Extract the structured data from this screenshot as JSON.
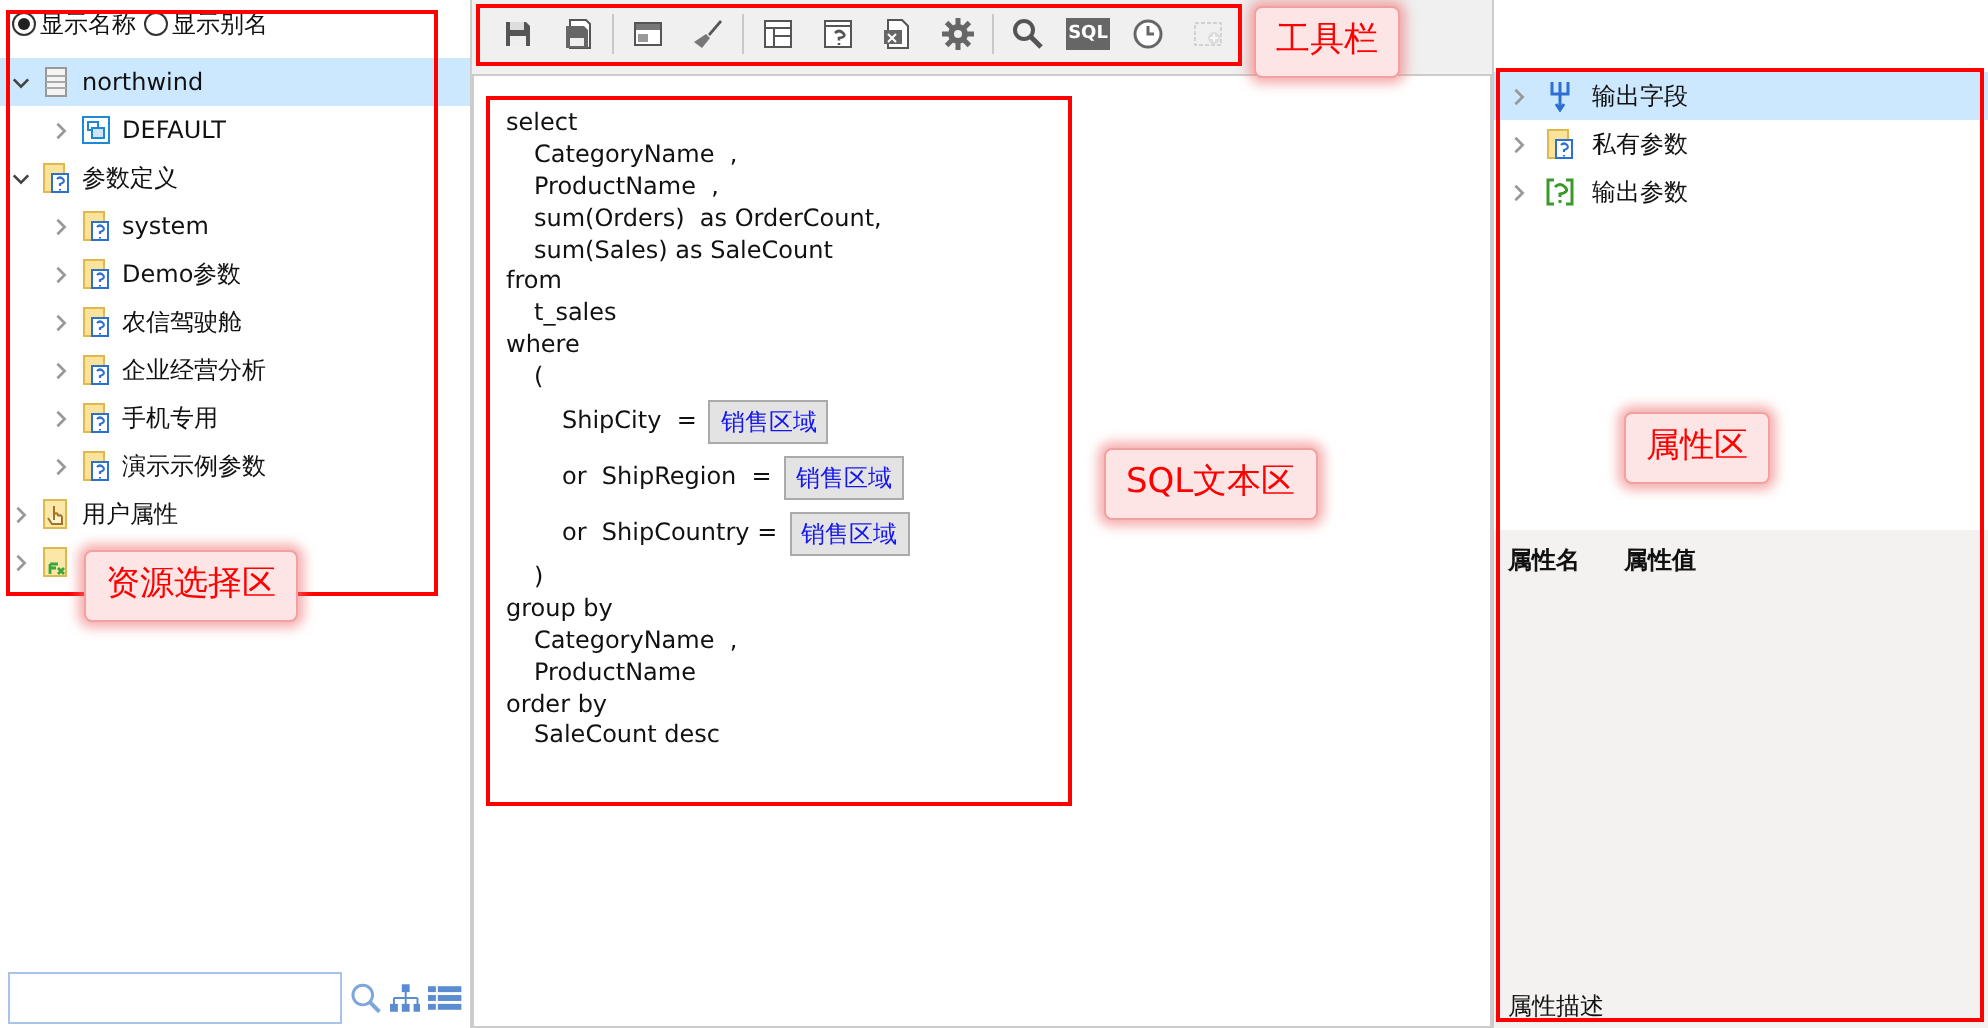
{
  "resource_panel": {
    "display_options": [
      {
        "label": "显示名称",
        "selected": true
      },
      {
        "label": "显示别名",
        "selected": false
      }
    ],
    "tree": [
      {
        "kind": "database",
        "label": "northwind",
        "expanded": true,
        "selected": true,
        "children": [
          {
            "kind": "schema",
            "label": "DEFAULT",
            "expanded": false,
            "selected": false
          }
        ]
      },
      {
        "kind": "param",
        "label": "参数定义",
        "expanded": true,
        "selected": false,
        "children": [
          {
            "kind": "param",
            "label": "system",
            "expanded": false,
            "selected": false
          },
          {
            "kind": "param",
            "label": "Demo参数",
            "expanded": false,
            "selected": false
          },
          {
            "kind": "param",
            "label": "农信驾驶舱",
            "expanded": false,
            "selected": false
          },
          {
            "kind": "param",
            "label": "企业经营分析",
            "expanded": false,
            "selected": false
          },
          {
            "kind": "param",
            "label": "手机专用",
            "expanded": false,
            "selected": false
          },
          {
            "kind": "param",
            "label": "演示示例参数",
            "expanded": false,
            "selected": false
          }
        ]
      },
      {
        "kind": "user",
        "label": "用户属性",
        "expanded": false,
        "selected": false
      },
      {
        "kind": "function",
        "expanded": false,
        "selected": false
      }
    ],
    "callout": "资源选择区"
  },
  "toolbar": {
    "groups": [
      [
        {
          "kind": "save"
        },
        {
          "kind": "save-as"
        }
      ],
      [
        {
          "kind": "layout"
        },
        {
          "kind": "brush"
        }
      ],
      [
        {
          "kind": "table"
        },
        {
          "kind": "param"
        },
        {
          "kind": "export"
        },
        {
          "kind": "gear"
        }
      ],
      [
        {
          "kind": "search"
        },
        {
          "kind": "sql",
          "label": "SQL"
        },
        {
          "kind": "clock"
        },
        {
          "kind": "add",
          "disabled": true
        }
      ]
    ],
    "callout": "工具栏"
  },
  "sql_editor": {
    "lines": [
      {
        "kind": "clause",
        "text": "select"
      },
      {
        "kind": "item",
        "text": "CategoryName  ,"
      },
      {
        "kind": "item",
        "text": "ProductName  ,"
      },
      {
        "kind": "item",
        "text": "sum(Orders)  as OrderCount,"
      },
      {
        "kind": "item",
        "text": "sum(Sales) as SaleCount"
      },
      {
        "kind": "clause",
        "text": "from"
      },
      {
        "kind": "item",
        "text": "t_sales"
      },
      {
        "kind": "clause",
        "text": "where"
      },
      {
        "kind": "item",
        "text": "("
      },
      {
        "kind": "condition",
        "text": "ShipCity  =",
        "param": "销售区域"
      },
      {
        "kind": "condition",
        "text": "or  ShipRegion  =",
        "param": "销售区域"
      },
      {
        "kind": "condition",
        "text": "or  ShipCountry =",
        "param": "销售区域"
      },
      {
        "kind": "item",
        "text": ")"
      },
      {
        "kind": "clause",
        "text": "group by"
      },
      {
        "kind": "item",
        "text": "CategoryName  ,"
      },
      {
        "kind": "item",
        "text": "ProductName"
      },
      {
        "kind": "clause",
        "text": "order by"
      },
      {
        "kind": "item",
        "text": "SaleCount desc"
      }
    ],
    "callout": "SQL文本区"
  },
  "property_panel": {
    "tree": [
      {
        "kind": "fields",
        "label": "输出字段",
        "selected": true
      },
      {
        "kind": "param",
        "label": "私有参数",
        "selected": false
      },
      {
        "kind": "output-param",
        "label": "输出参数",
        "selected": false
      }
    ],
    "grid_columns": [
      "属性名",
      "属性值"
    ],
    "description_label": "属性描述",
    "callout": "属性区"
  }
}
